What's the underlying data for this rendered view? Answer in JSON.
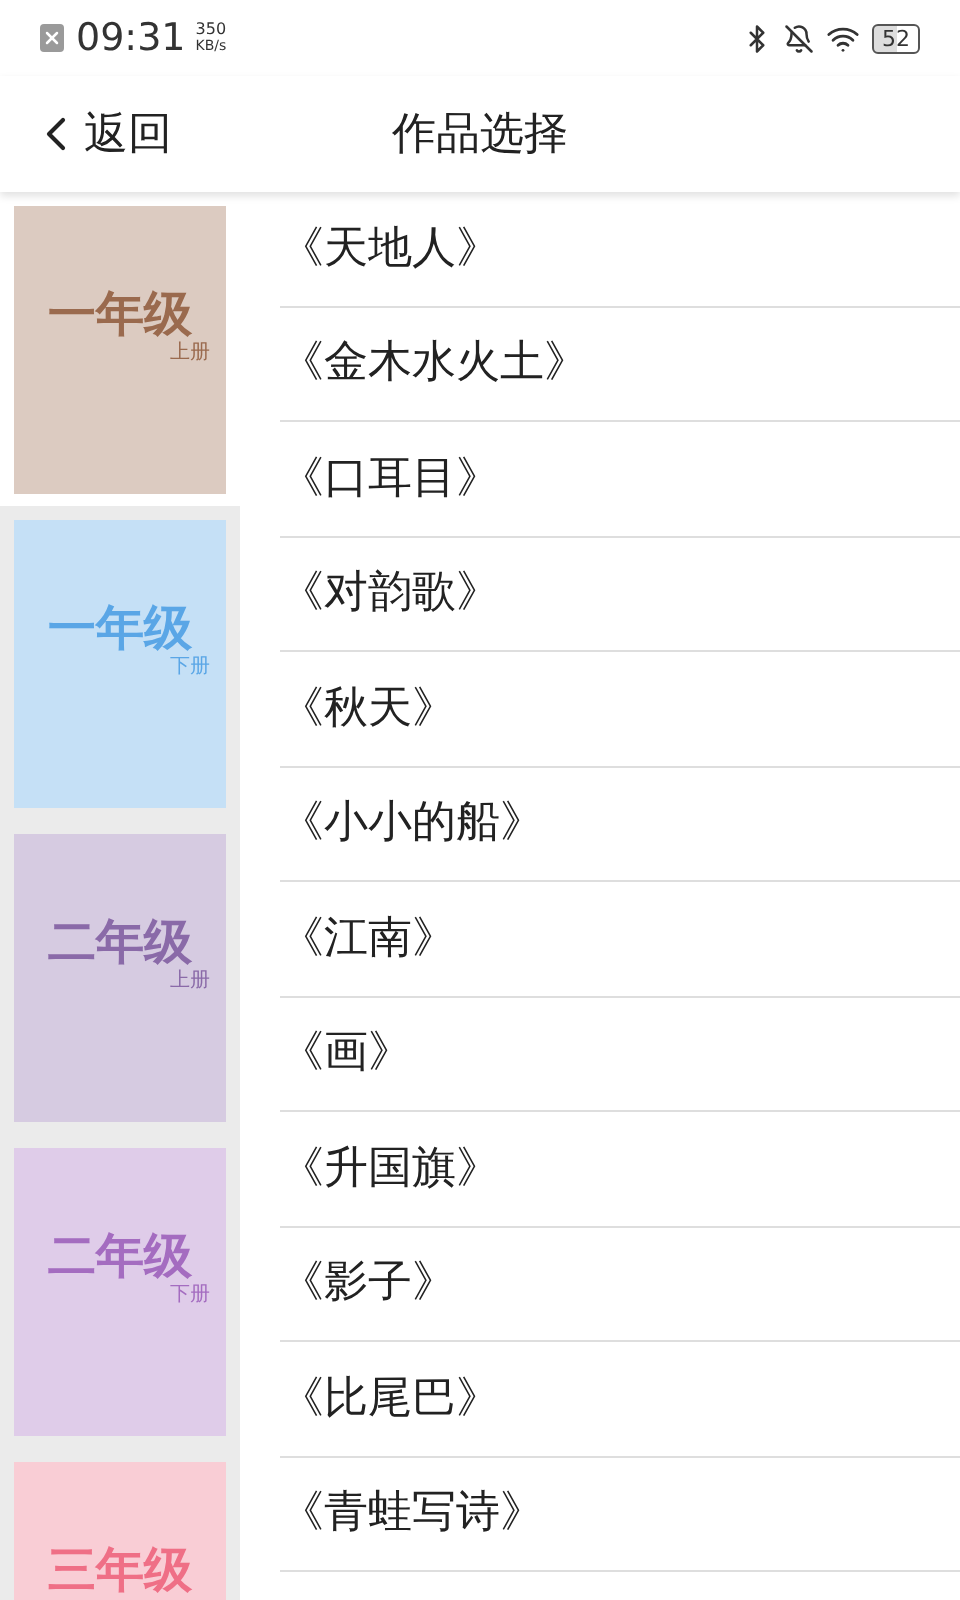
{
  "status_bar": {
    "time": "09:31",
    "speed_value": "350",
    "speed_unit": "KB/s",
    "battery": "52"
  },
  "header": {
    "back": "返回",
    "title": "作品选择"
  },
  "covers": [
    {
      "title": "一年级",
      "volume": "上册",
      "color": "#9a6a4e",
      "selected": true
    },
    {
      "title": "一年级",
      "volume": "下册",
      "color": "#5aa6e6",
      "selected": false
    },
    {
      "title": "二年级",
      "volume": "上册",
      "color": "#8a6aa8",
      "selected": false
    },
    {
      "title": "二年级",
      "volume": "下册",
      "color": "#a46cc0",
      "selected": false
    },
    {
      "title": "三年级",
      "color": "#ef6f86",
      "selected": false
    }
  ],
  "works": [
    "《天地人》",
    "《金木水火土》",
    "《口耳目》",
    "《对韵歌》",
    "《秋天》",
    "《小小的船》",
    "《江南》",
    "《画》",
    "《升国旗》",
    "《影子》",
    "《比尾巴》",
    "《青蛙写诗》"
  ]
}
